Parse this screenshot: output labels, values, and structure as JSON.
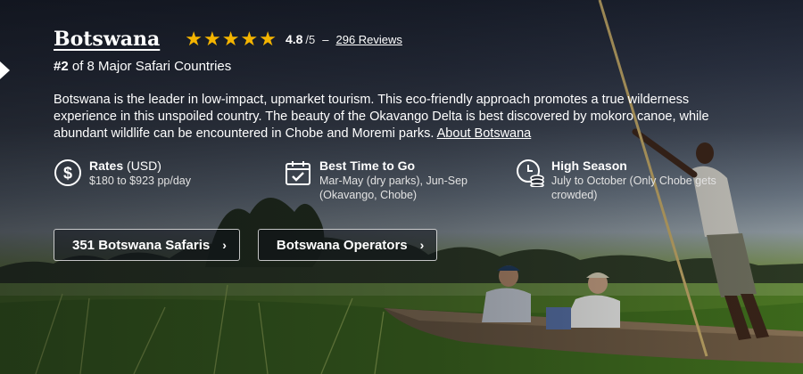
{
  "country": {
    "title": "Botswana",
    "rating_value": "4.8",
    "rating_max": "/5",
    "separator": "–",
    "reviews_link": "296 Reviews",
    "stars_filled": 5,
    "rank_number": "#2",
    "rank_suffix": " of 8 Major Safari Countries",
    "description": "Botswana is the leader in low-impact, upmarket tourism. This eco-friendly approach promotes a true wilderness experience in this unspoiled country. The beauty of the Okavango Delta is best discovered by mokoro canoe, while abundant wildlife can be encountered in Chobe and Moremi parks. ",
    "about_link": "About Botswana"
  },
  "facts": [
    {
      "icon": "dollar-icon",
      "title": "Rates",
      "title_suffix": " (USD)",
      "text": "$180 to $923 pp/day"
    },
    {
      "icon": "calendar-check-icon",
      "title": "Best Time to Go",
      "text": "Mar-May (dry parks), Jun-Sep (Okavango, Chobe)"
    },
    {
      "icon": "clock-coins-icon",
      "title": "High Season",
      "text": "July to October (Only Chobe gets crowded)"
    }
  ],
  "buttons": {
    "safaris": "351 Botswana Safaris",
    "operators": "Botswana Operators",
    "chevron": "›"
  },
  "colors": {
    "star": "#f4b400",
    "text": "#ffffff"
  }
}
